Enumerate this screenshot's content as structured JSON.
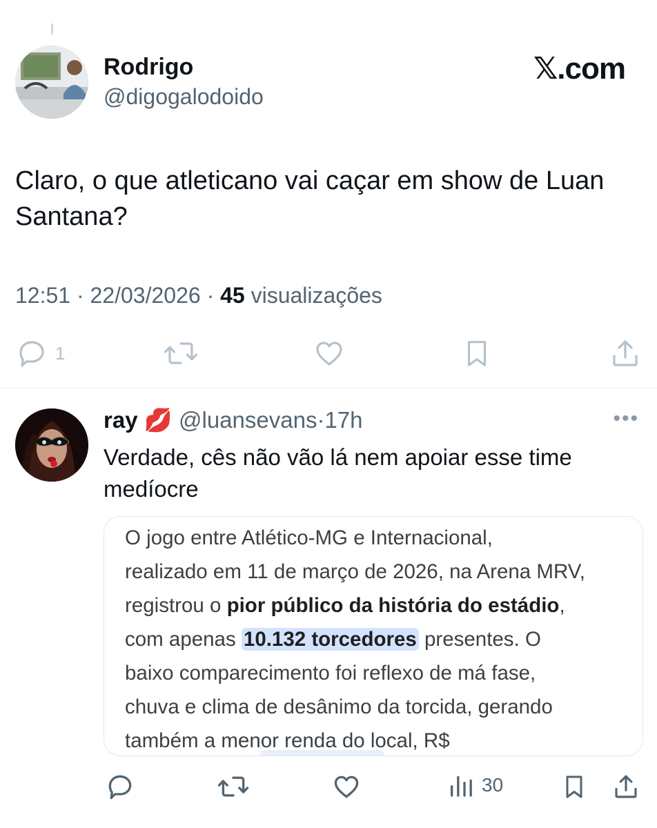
{
  "tweet": {
    "author_name": "Rodrigo",
    "author_handle": "@digogalodoido",
    "brand": "𝕏.com",
    "text": "Claro, o que atleticano vai caçar em show de Luan Santana?",
    "time": "12:51",
    "date": "22/03/2026",
    "views_count": "45",
    "views_label": "visualizações",
    "reply_count": "1",
    "icons": [
      "reply-icon",
      "retweet-icon",
      "like-icon",
      "bookmark-icon",
      "share-icon"
    ]
  },
  "reply": {
    "author_name": "ray",
    "emoji": "💋",
    "author_handle": "@luansevans",
    "time": "17h",
    "more": "•••",
    "text": "Verdade, cês não vão lá nem apoiar esse time medíocre",
    "card": {
      "line1": "O jogo entre Atlético-MG e Internacional,",
      "line2": "realizado em 11 de março de 2026, na Arena MRV,",
      "line3_pre": "registrou o ",
      "line3_bold": "pior público da história do estádio",
      "line3_post": ",",
      "line4_pre": "com apenas ",
      "line4_highlight": "10.132 torcedores",
      "line4_post": " presentes. O",
      "line5": "baixo comparecimento foi reflexo de má fase,",
      "line6": "chuva e clima de desânimo da torcida, gerando",
      "line7": "também a menor renda do local, R$"
    },
    "views_count": "30",
    "icons": [
      "reply-icon",
      "retweet-icon",
      "like-icon",
      "views-icon",
      "bookmark-icon",
      "share-icon"
    ]
  },
  "colors": {
    "text": "#0f1419",
    "secondary": "#536471",
    "highlight": "#d3e3fd",
    "divider": "#eff3f4"
  }
}
